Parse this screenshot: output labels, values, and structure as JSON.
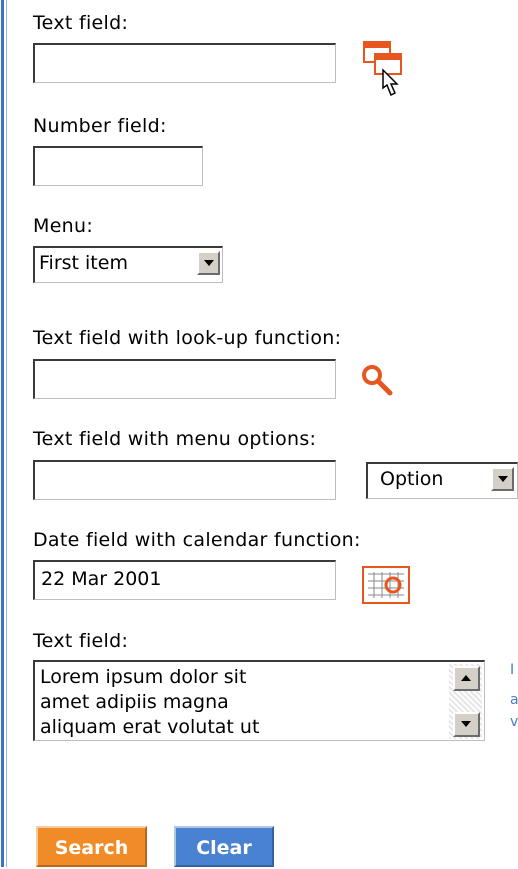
{
  "labels": {
    "text_field": "Text field:",
    "number_field": "Number field:",
    "menu": "Menu:",
    "lookup": "Text field with look-up function:",
    "menu_options": "Text field with menu options:",
    "date": "Date field with calendar function:",
    "text_field_2": "Text field:"
  },
  "fields": {
    "text_field_value": "",
    "number_field_value": "",
    "menu_selected": "First item",
    "lookup_value": "",
    "menu_options_value": "",
    "option_selected": "Option",
    "date_value": "22 Mar 2001",
    "textarea_lines": [
      "Lorem ipsum dolor sit",
      "amet adipiis magna",
      "aliquam erat volutat ut"
    ]
  },
  "buttons": {
    "search": "Search",
    "clear": "Clear"
  },
  "side_text": [
    "I",
    "a",
    "v"
  ],
  "colors": {
    "search_button": "#f08c28",
    "clear_button": "#4a82d2",
    "icon_orange": "#e8561f"
  },
  "icons": [
    "window-pointer-icon",
    "magnifier-icon",
    "calendar-icon",
    "scroll-up-icon",
    "scroll-down-icon",
    "dropdown-arrow-icon"
  ]
}
